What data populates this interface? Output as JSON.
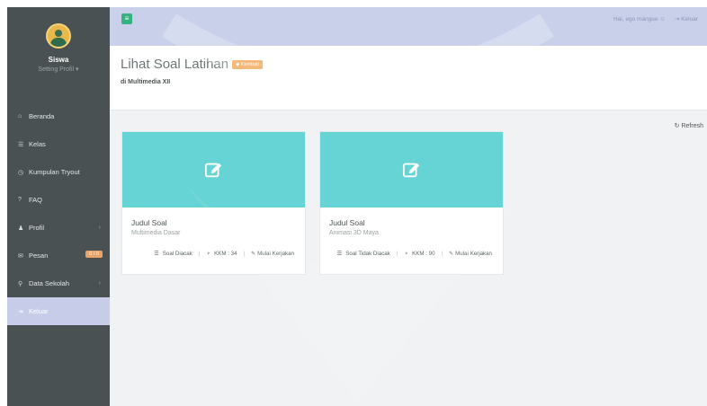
{
  "sidebar": {
    "profile": {
      "name": "Siswa",
      "setting": "Setting Profil ▾"
    },
    "items": [
      {
        "icon": "home-icon",
        "glyph": "⌂",
        "label": "Beranda"
      },
      {
        "icon": "graduation-cap-icon",
        "glyph": "☰",
        "label": "Kelas"
      },
      {
        "icon": "clock-icon",
        "glyph": "◷",
        "label": "Kumpulan Tryout"
      },
      {
        "icon": "question-icon",
        "glyph": "?",
        "label": "FAQ"
      },
      {
        "icon": "user-icon",
        "glyph": "♟",
        "label": "Profil",
        "chevron": "‹"
      },
      {
        "icon": "mail-icon",
        "glyph": "✉",
        "label": "Pesan",
        "badge": "0 / 0"
      },
      {
        "icon": "search-icon",
        "glyph": "⚲",
        "label": "Data Sekolah",
        "chevron": "‹"
      },
      {
        "icon": "logout-icon",
        "glyph": "⇥",
        "label": "Keluar"
      }
    ]
  },
  "topbar": {
    "greeting": "Hai, ego mangue ☺",
    "logout": "Keluar"
  },
  "header": {
    "title": "Lihat Soal Latihan",
    "back_button": "◆ Kembali",
    "subtitle": "di Multimedia XII",
    "refresh": "Refresh"
  },
  "cards": [
    {
      "label": "Judul Soal",
      "name": "Multimedia Dasar",
      "soal": "Soal Diacak",
      "kkm": "KKM : 34",
      "action": "Mulai Kerjakan"
    },
    {
      "label": "Judul Soal",
      "name": "Animasi 3D Maya",
      "soal": "Soal Tidak Diacak",
      "kkm": "KKM : 90",
      "action": "Mulai Kerjakan"
    }
  ],
  "colors": {
    "sidebar": "#4a5152",
    "topbar": "#c9d1ea",
    "accent_green": "#34b27f",
    "card_hero": "#66d3d4",
    "back_button": "#f0a04b",
    "active_nav": "#c7cde9"
  }
}
